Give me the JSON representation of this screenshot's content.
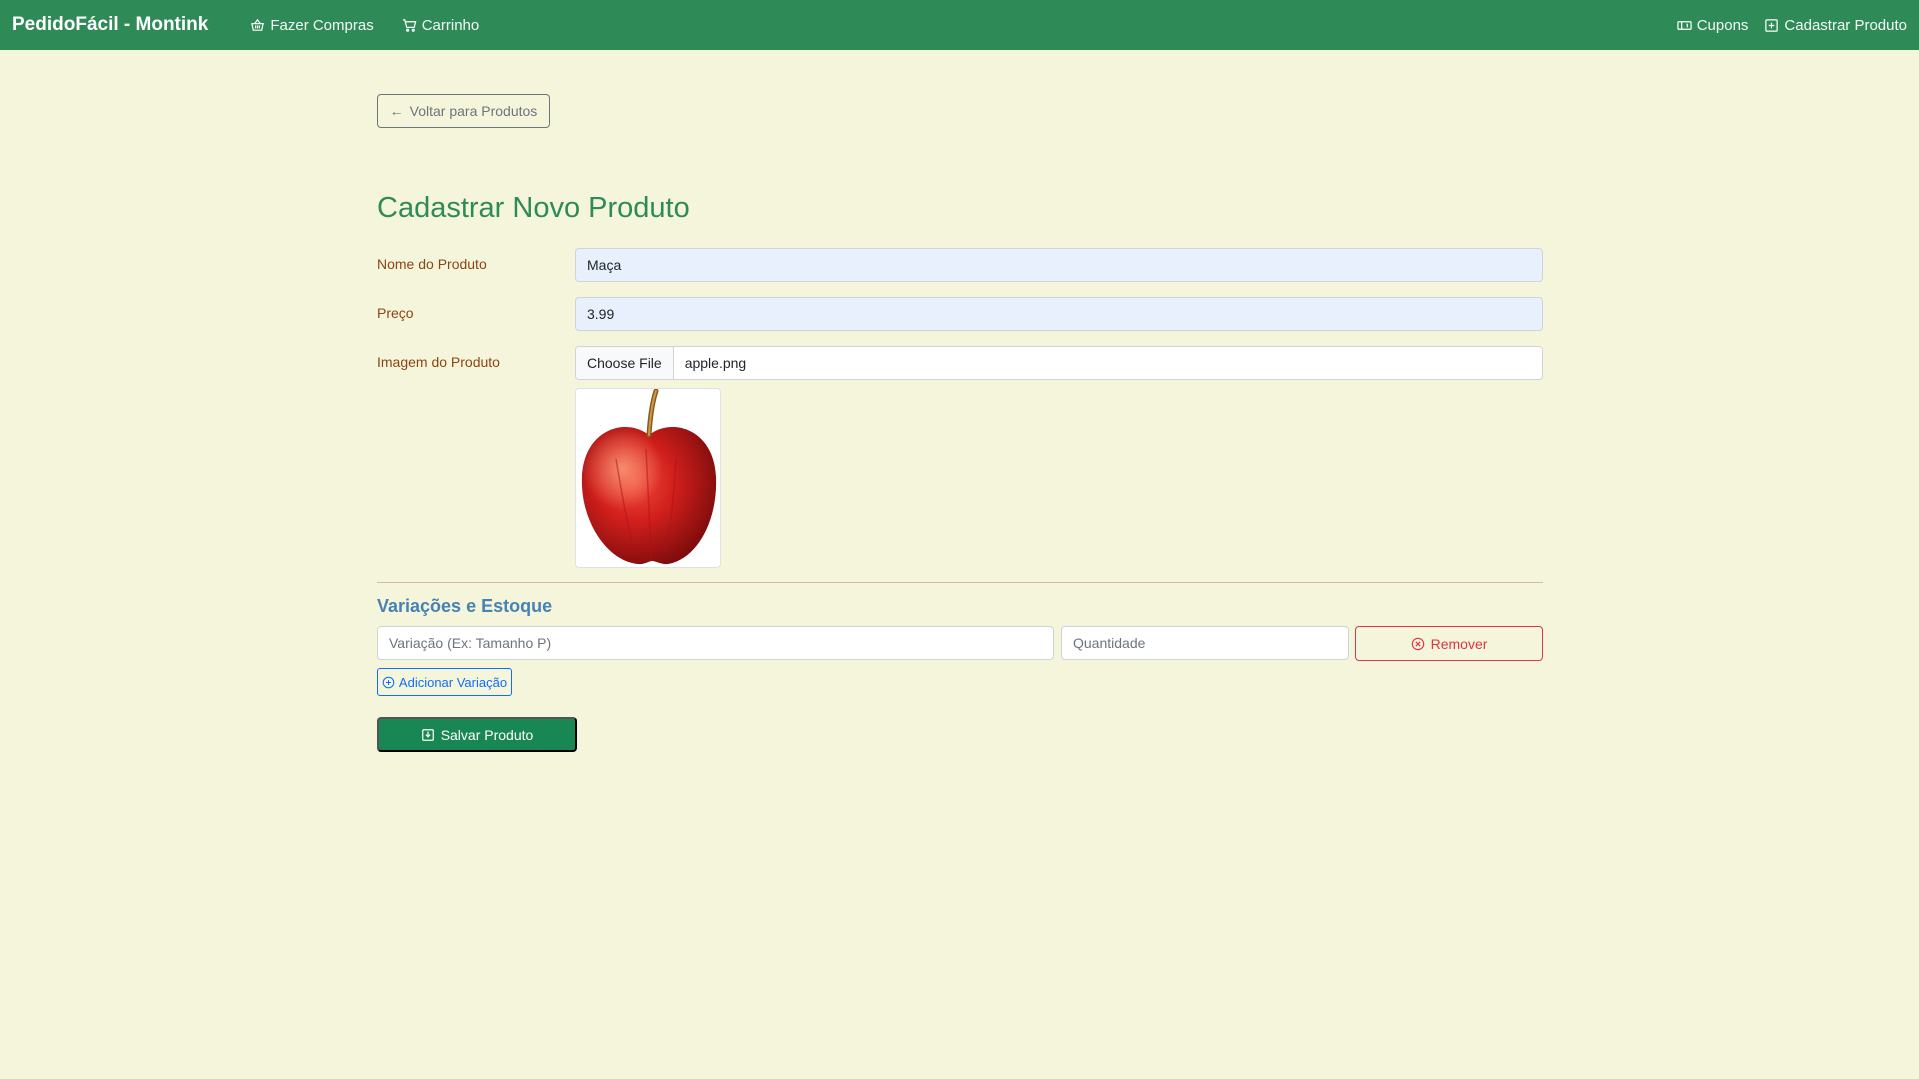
{
  "navbar": {
    "brand": "PedidoFácil - Montink",
    "links_left": [
      {
        "label": "Fazer Compras",
        "icon": "basket-icon"
      },
      {
        "label": "Carrinho",
        "icon": "cart-icon"
      }
    ],
    "links_right": [
      {
        "label": "Cupons",
        "icon": "ticket-icon"
      },
      {
        "label": "Cadastrar Produto",
        "icon": "plus-square-icon"
      }
    ],
    "background": "#2e8b57"
  },
  "page": {
    "back_label": "Voltar para Produtos",
    "title": "Cadastrar Novo Produto"
  },
  "form": {
    "name_label": "Nome do Produto",
    "name_value": "Maça",
    "price_label": "Preço",
    "price_value": "3.99",
    "image_label": "Imagem do Produto",
    "file_button": "Choose File",
    "file_name": "apple.png"
  },
  "variations": {
    "title": "Variações e Estoque",
    "variation_placeholder": "Variação (Ex: Tamanho P)",
    "quantity_placeholder": "Quantidade",
    "remove_label": "Remover",
    "add_label": "Adicionar Variação"
  },
  "save_label": "Salvar Produto",
  "colors": {
    "page_bg": "#f5f5dc",
    "title": "#2e8b57",
    "label": "#8b4513",
    "section": "#4682b4",
    "danger": "#dc3545",
    "primary": "#0d6efd",
    "success": "#198754"
  }
}
